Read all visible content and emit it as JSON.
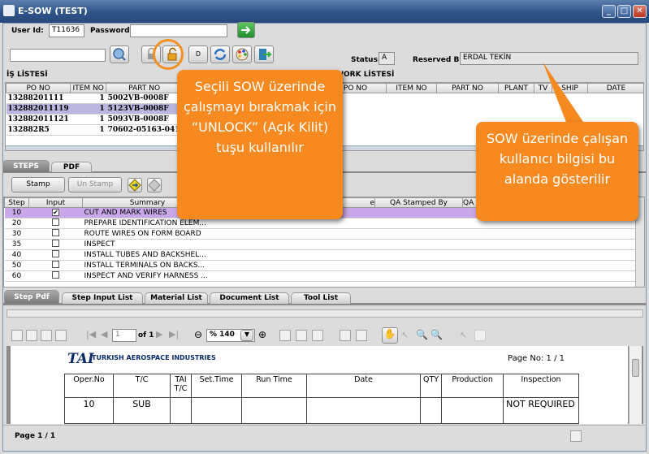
{
  "window": {
    "title": "E-SOW (TEST)",
    "buttons": [
      "_",
      "□",
      "✕"
    ]
  },
  "login": {
    "user_label": "User Id:",
    "user_value": "T11636",
    "password_label": "Password:"
  },
  "toolbar": {
    "d_label": "D"
  },
  "status": {
    "label": "Status:",
    "value": "A",
    "reserved_label": "Reserved By:",
    "reserved_value": "ERDAL TEKİN"
  },
  "is_listesi": {
    "title": "İŞ LİSTESİ",
    "columns": [
      "PO NO",
      "ITEM NO",
      "PART NO"
    ],
    "rows": [
      [
        "13288201111",
        "1",
        "5002VB-0008F"
      ],
      [
        "132882011119",
        "1",
        "5123VB-0008F"
      ],
      [
        "132882011121",
        "1",
        "5093VB-0008F"
      ],
      [
        "132882R5",
        "1",
        "70602-05163-041"
      ]
    ]
  },
  "rework": {
    "title": "REWORK LİSTESİ",
    "columns": [
      "PO NO",
      "ITEM NO",
      "PART NO",
      "PLANT",
      "TV",
      "SHIP",
      "DATE"
    ]
  },
  "tabs_top": [
    "STEPS",
    "PDF"
  ],
  "steps_toolbar": {
    "stamp": "Stamp",
    "unstamp": "Un Stamp"
  },
  "steps": {
    "columns": [
      "Step",
      "Input",
      "Summary",
      "",
      "e",
      "QA Stamped By",
      "QA"
    ],
    "rows": [
      {
        "step": "10",
        "input": true,
        "summary": "CUT AND MARK WIRES"
      },
      {
        "step": "20",
        "input": false,
        "summary": "PREPARE IDENTIFICATION ELEM..."
      },
      {
        "step": "30",
        "input": false,
        "summary": "ROUTE WIRES ON FORM BOARD"
      },
      {
        "step": "35",
        "input": false,
        "summary": "INSPECT"
      },
      {
        "step": "40",
        "input": false,
        "summary": "INSTALL TUBES AND BACKSHEL..."
      },
      {
        "step": "50",
        "input": false,
        "summary": "INSTALL TERMINALS ON BACKS..."
      },
      {
        "step": "60",
        "input": false,
        "summary": "INSPECT AND VERIFY HARNESS ..."
      }
    ]
  },
  "tabs_bottom": [
    "Step Pdf",
    "Step Input List",
    "Material List",
    "Document List",
    "Tool List"
  ],
  "pdf_toolbar": {
    "page_value": "1",
    "of_label": "of 1",
    "zoom": "% 140"
  },
  "pdf_doc": {
    "company": "TURKISH AEROSPACE INDUSTRIES",
    "logo": "TAI",
    "page_no": "Page No: 1    / 1",
    "columns": [
      "Oper.No",
      "T/C",
      "TAI T/C",
      "Set.Time",
      "Run Time",
      "Date",
      "QTY",
      "Production",
      "Inspection"
    ],
    "row": {
      "oper": "10",
      "tc": "SUB",
      "inspection": "NOT REQUIRED"
    }
  },
  "statusbar": {
    "page": "Page 1 / 1"
  },
  "callouts": {
    "left": "Seçili SOW üzerinde çalışmayı bırakmak için “UNLOCK” (Açık Kilit) tuşu kullanılır",
    "right": "SOW üzerinde çalışan kullanıcı bilgisi bu alanda gösterilir"
  },
  "colors": {
    "highlight_row": "#b9b6df",
    "step_row_sel": "#c8a8e8",
    "callout": "#f6891f",
    "orange_ring": "#f39021"
  }
}
